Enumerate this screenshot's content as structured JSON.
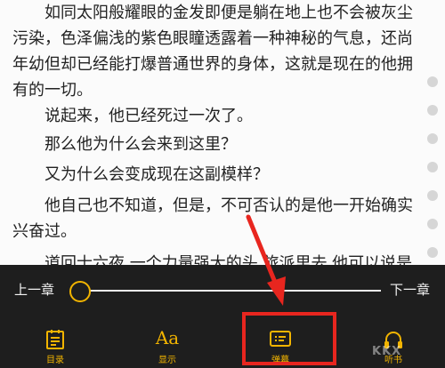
{
  "reader": {
    "paragraphs": [
      "如同太阳般耀眼的金发即便是躺在地上也不会被灰尘污染，色泽偏浅的紫色眼瞳透露着一种神秘的气息，还尚年幼但却已经能打爆普通世界的身体，这就是现在的他拥有的一切。",
      "说起来，他已经死过一次了。",
      "那么他为什么会来到这里？",
      "又为什么会变成现在这副模样？",
      "他自己也不知道，但是，不可否认的是他一开始确实兴奋过。",
      "道回士六夜 一个力量强大的头 旅派里去 他可以说是"
    ]
  },
  "chapter_nav": {
    "prev_label": "上一章",
    "next_label": "下一章",
    "progress": 0.0
  },
  "toolbar": {
    "tabs": [
      {
        "label": "目录",
        "icon": "catalog-icon"
      },
      {
        "label": "显示",
        "icon": "font-display-icon",
        "glyph": "Aa"
      },
      {
        "label": "弹幕",
        "icon": "danmaku-icon"
      },
      {
        "label": "听书",
        "icon": "headphones-icon"
      }
    ]
  },
  "watermark": {
    "text": "KKX"
  },
  "colors": {
    "accent": "#f2b400",
    "panel_bg": "#1e1e1e",
    "highlight": "#e8261f",
    "text": "#222222"
  }
}
